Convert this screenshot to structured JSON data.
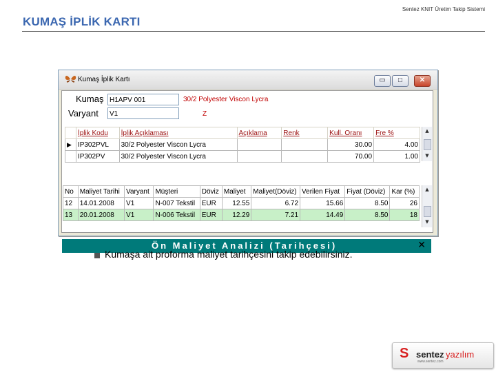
{
  "header": {
    "right_text": "Sentez KNIT Üretim Takip Sistemi",
    "page_title": "KUMAŞ İPLİK KARTI"
  },
  "window": {
    "title": "Kumaş İplik Kartı",
    "minimize_glyph": "▭",
    "maximize_glyph": "□",
    "close_glyph": "✕",
    "kumas_label": "Kumaş",
    "kumas_code": "H1APV 001",
    "kumas_desc": "30/2 Polyester Viscon Lycra",
    "varyant_label": "Varyant",
    "varyant_value": "V1",
    "varyant_extra": "Z"
  },
  "yarn_table": {
    "columns": [
      "İplik Kodu",
      "İplik Açıklaması",
      "Açıklama",
      "Renk",
      "Kull. Oranı",
      "Fre %"
    ],
    "rows": [
      {
        "indicator": "▶",
        "cells": [
          "IP302PVL",
          "30/2 Polyester Viscon Lycra",
          "",
          "",
          "30.00",
          "4.00"
        ]
      },
      {
        "indicator": "",
        "cells": [
          "IP302PV",
          "30/2 Polyester Viscon Lycra",
          "",
          "",
          "70.00",
          "1.00"
        ]
      }
    ]
  },
  "cost_panel": {
    "title": "Ön Maliyet Analizi (Tarihçesi)",
    "close_glyph": "✕",
    "columns": [
      "No",
      "Maliyet Tarihi",
      "Varyant",
      "Müşteri",
      "Döviz",
      "Maliyet",
      "Maliyet(Döviz)",
      "Verilen Fiyat",
      "Fiyat (Döviz)",
      "Kar (%)"
    ],
    "rows": [
      [
        "12",
        "14.01.2008",
        "V1",
        "N-007 Tekstil",
        "EUR",
        "12.55",
        "6.72",
        "15.66",
        "8.50",
        "26"
      ],
      [
        "13",
        "20.01.2008",
        "V1",
        "N-006 Tekstil",
        "EUR",
        "12.29",
        "7.21",
        "14.49",
        "8.50",
        "18"
      ]
    ]
  },
  "bullet": {
    "text": "Kumaşa ait proforma maliyet tarihçesini takip edebilirsiniz."
  },
  "logo": {
    "mark": "S",
    "name_a": "sentez",
    "name_b": "yazılım",
    "sub": "www.sentez.com"
  }
}
